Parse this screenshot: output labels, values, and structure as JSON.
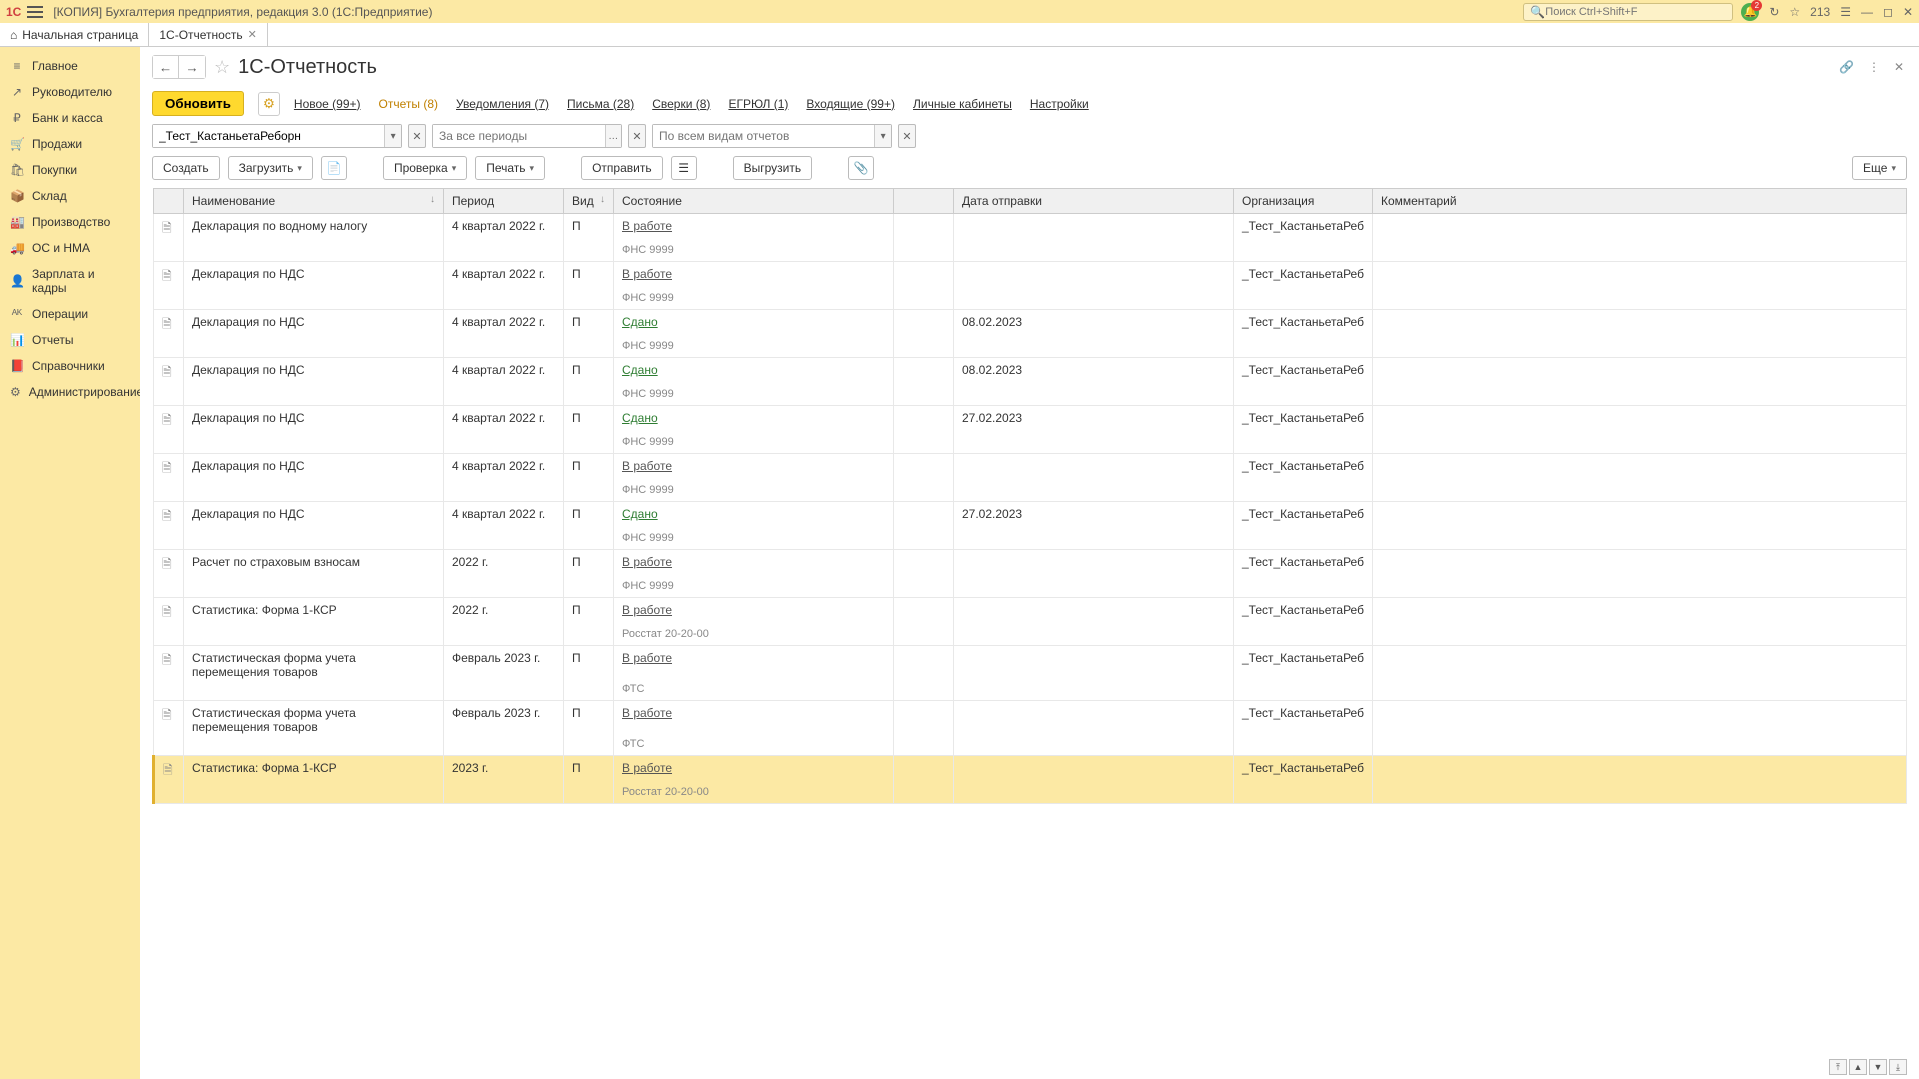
{
  "titlebar": {
    "logo": "1C",
    "title": "[КОПИЯ] Бухгалтерия предприятия, редакция 3.0  (1С:Предприятие)",
    "search_placeholder": "Поиск Ctrl+Shift+F",
    "notif_badge": "2",
    "count": "213"
  },
  "tabs": {
    "home": "Начальная страница",
    "active": "1С-Отчетность"
  },
  "sidebar": {
    "items": [
      {
        "icon": "≡",
        "label": "Главное"
      },
      {
        "icon": "↗",
        "label": "Руководителю"
      },
      {
        "icon": "₽",
        "label": "Банк и касса"
      },
      {
        "icon": "🛒",
        "label": "Продажи"
      },
      {
        "icon": "🛍",
        "label": "Покупки"
      },
      {
        "icon": "📦",
        "label": "Склад"
      },
      {
        "icon": "🏭",
        "label": "Производство"
      },
      {
        "icon": "🚚",
        "label": "ОС и НМА"
      },
      {
        "icon": "👤",
        "label": "Зарплата и кадры"
      },
      {
        "icon": "ᴬᴷ",
        "label": "Операции"
      },
      {
        "icon": "📊",
        "label": "Отчеты"
      },
      {
        "icon": "📕",
        "label": "Справочники"
      },
      {
        "icon": "⚙",
        "label": "Администрирование"
      }
    ]
  },
  "page": {
    "title": "1С-Отчетность",
    "refresh": "Обновить",
    "subtabs": [
      {
        "label": "Новое (99+)"
      },
      {
        "label": "Отчеты (8)",
        "active": true
      },
      {
        "label": "Уведомления (7)"
      },
      {
        "label": "Письма (28)"
      },
      {
        "label": "Сверки (8)"
      },
      {
        "label": "ЕГРЮЛ (1)"
      },
      {
        "label": "Входящие (99+)"
      },
      {
        "label": "Личные кабинеты"
      },
      {
        "label": "Настройки"
      }
    ]
  },
  "filters": {
    "org": "_Тест_КастаньетаРеборн",
    "period_placeholder": "За все периоды",
    "type_placeholder": "По всем видам отчетов"
  },
  "toolbar": {
    "create": "Создать",
    "load": "Загрузить",
    "check": "Проверка",
    "print": "Печать",
    "send": "Отправить",
    "export": "Выгрузить",
    "more": "Еще"
  },
  "columns": {
    "name": "Наименование",
    "period": "Период",
    "type": "Вид",
    "status": "Состояние",
    "sent": "Дата отправки",
    "org": "Организация",
    "comment": "Комментарий"
  },
  "rows": [
    {
      "name": "Декларация по водному налогу",
      "period": "4 квартал 2022 г.",
      "type": "П",
      "status": "В работе",
      "status_cls": "work",
      "dept": "ФНС 9999",
      "sent": "",
      "org": "_Тест_КастаньетаРеб"
    },
    {
      "name": "Декларация по НДС",
      "period": "4 квартал 2022 г.",
      "type": "П",
      "status": "В работе",
      "status_cls": "work",
      "dept": "ФНС 9999",
      "sent": "",
      "org": "_Тест_КастаньетаРеб"
    },
    {
      "name": "Декларация по НДС",
      "period": "4 квартал 2022 г.",
      "type": "П",
      "status": "Сдано",
      "status_cls": "done",
      "dept": "ФНС 9999",
      "sent": "08.02.2023",
      "org": "_Тест_КастаньетаРеб"
    },
    {
      "name": "Декларация по НДС",
      "period": "4 квартал 2022 г.",
      "type": "П",
      "status": "Сдано",
      "status_cls": "done",
      "dept": "ФНС 9999",
      "sent": "08.02.2023",
      "org": "_Тест_КастаньетаРеб"
    },
    {
      "name": "Декларация по НДС",
      "period": "4 квартал 2022 г.",
      "type": "П",
      "status": "Сдано",
      "status_cls": "done",
      "dept": "ФНС 9999",
      "sent": "27.02.2023",
      "org": "_Тест_КастаньетаРеб"
    },
    {
      "name": "Декларация по НДС",
      "period": "4 квартал 2022 г.",
      "type": "П",
      "status": "В работе",
      "status_cls": "work",
      "dept": "ФНС 9999",
      "sent": "",
      "org": "_Тест_КастаньетаРеб"
    },
    {
      "name": "Декларация по НДС",
      "period": "4 квартал 2022 г.",
      "type": "П",
      "status": "Сдано",
      "status_cls": "done",
      "dept": "ФНС 9999",
      "sent": "27.02.2023",
      "org": "_Тест_КастаньетаРеб"
    },
    {
      "name": "Расчет по страховым взносам",
      "period": "2022 г.",
      "type": "П",
      "status": "В работе",
      "status_cls": "work",
      "dept": "ФНС 9999",
      "sent": "",
      "org": "_Тест_КастаньетаРеб"
    },
    {
      "name": "Статистика: Форма 1-КСР",
      "period": "2022 г.",
      "type": "П",
      "status": "В работе",
      "status_cls": "work",
      "dept": "Росстат 20-20-00",
      "sent": "",
      "org": "_Тест_КастаньетаРеб"
    },
    {
      "name": "Статистическая форма учета перемещения товаров",
      "period": "Февраль 2023 г.",
      "type": "П",
      "status": "В работе",
      "status_cls": "work",
      "dept": "ФТС",
      "sent": "",
      "org": "_Тест_КастаньетаРеб"
    },
    {
      "name": "Статистическая форма учета перемещения товаров",
      "period": "Февраль 2023 г.",
      "type": "П",
      "status": "В работе",
      "status_cls": "work",
      "dept": "ФТС",
      "sent": "",
      "org": "_Тест_КастаньетаРеб"
    },
    {
      "name": "Статистика: Форма 1-КСР",
      "period": "2023 г.",
      "type": "П",
      "status": "В работе",
      "status_cls": "work",
      "dept": "Росстат 20-20-00",
      "sent": "",
      "org": "_Тест_КастаньетаРеб",
      "selected": true
    }
  ]
}
